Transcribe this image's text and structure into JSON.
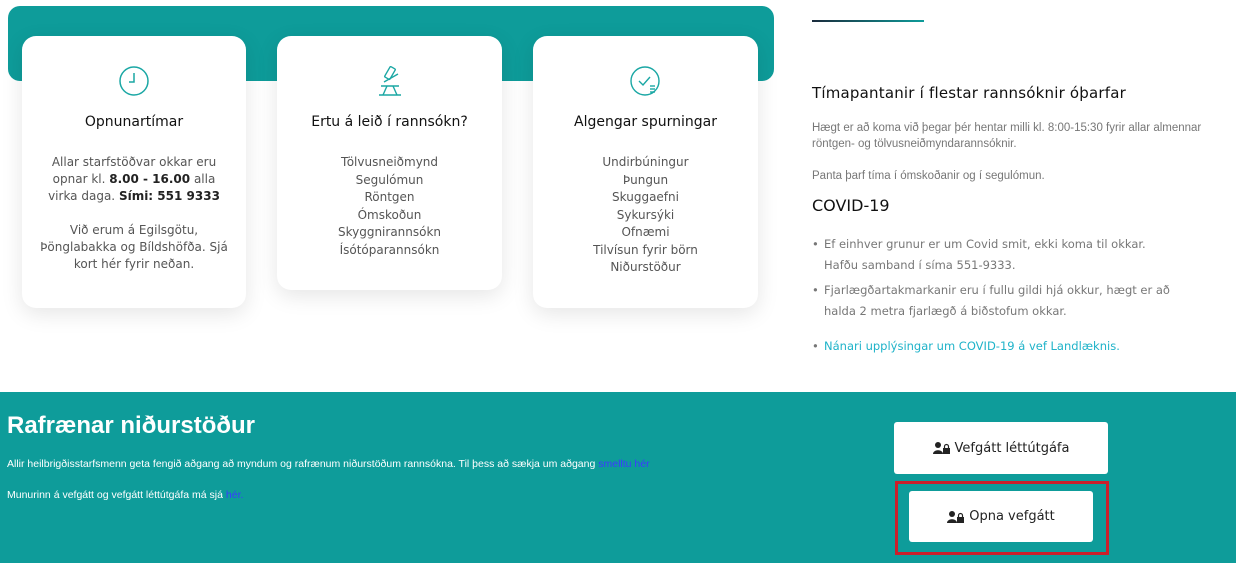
{
  "cards": [
    {
      "title": "Opnunartímar",
      "icon": "clock-icon",
      "para1_a": "Allar starfstöðvar okkar eru opnar  kl. ",
      "para1_hours": "8.00 - 16.00",
      "para1_b": " alla virka daga. ",
      "para1_phone": "Sími: 551 9333",
      "para2": "Við erum á Egilsgötu, Þönglabakka og Bíldshöfða. Sjá kort hér fyrir neðan."
    },
    {
      "title": "Ertu á leið í rannsókn?",
      "icon": "microscope-icon",
      "items": [
        "Tölvusneiðmynd",
        "Segulómun",
        "Röntgen",
        "Ómskoðun",
        "Skyggnirannsókn",
        "Ísótóparannsókn"
      ]
    },
    {
      "title": "Algengar spurningar",
      "icon": "checklist-icon",
      "items": [
        "Undirbúningur",
        "Þungun",
        "Skuggaefni",
        "Sykursýki",
        "Ofnæmi",
        "Tilvísun fyrir börn",
        "Niðurstöður"
      ]
    }
  ],
  "info": {
    "heading": "Tímapantanir í flestar rannsóknir óþarfar",
    "para1": "Hægt er að koma við þegar þér hentar milli kl. 8:00-15:30 fyrir allar almennar röntgen- og tölvusneiðmyndarannsóknir.",
    "para2": "Panta þarf tíma í ómskoðanir og í segulómun.",
    "covid_heading": "COVID-19",
    "bullets": [
      "Ef einhver grunur er um Covid smit, ekki koma til okkar. Hafðu samband í síma 551-9333.",
      "Fjarlægðartakmarkanir eru í fullu gildi hjá okkur, hægt er að halda 2 metra fjarlægð á biðstofum okkar.",
      "Nánari upplýsingar um COVID-19 á vef Landlæknis."
    ]
  },
  "results": {
    "heading": "Rafrænar niðurstöður",
    "line1": "Allir heilbrigðisstarfsmenn geta fengið aðgang að myndum og rafrænum niðurstöðum rannsókna. Til þess að sækja um aðgang ",
    "line1_link": "smelltu hér",
    "line2": "Munurinn á vefgátt og vefgátt léttútgáfa má sjá ",
    "line2_link": "hér.",
    "button1": "Vefgátt léttútgáfa",
    "button2": "Opna vefgátt"
  },
  "colors": {
    "teal": "#0e9c9a",
    "highlight": "#cc1f2a",
    "link_blue": "#3b3bff",
    "link_cyan": "#1fb3c9"
  }
}
